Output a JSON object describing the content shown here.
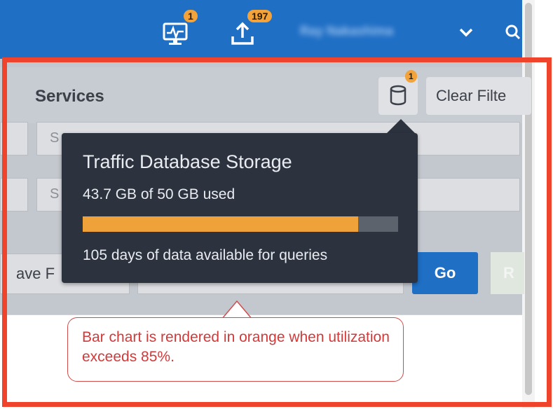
{
  "topbar": {
    "monitor_badge": "1",
    "upload_badge": "197",
    "user_name": "Ray Nakashima"
  },
  "services": {
    "title": "Services",
    "db_badge": "1",
    "clear_filter_label": "Clear Filte",
    "field1_placeholder": "S",
    "field2_placeholder": "S",
    "save_label": "ave F",
    "go_label": "Go",
    "reset_label": "R"
  },
  "tooltip": {
    "title": "Traffic Database Storage",
    "usage": "43.7 GB of 50 GB used",
    "used_gb": 43.7,
    "total_gb": 50,
    "used_fraction": 0.874,
    "days": "105 days of data available for queries"
  },
  "callout": {
    "text": "Bar chart is rendered in orange when utilization exceeds 85%."
  },
  "colors": {
    "accent": "#1f6fc5",
    "bar_warning": "#f0a23a",
    "highlight": "#f0432c",
    "callout_text": "#d23a3a"
  },
  "icons": [
    "monitor-icon",
    "upload-icon",
    "chevron-down-icon",
    "search-icon",
    "database-icon"
  ]
}
